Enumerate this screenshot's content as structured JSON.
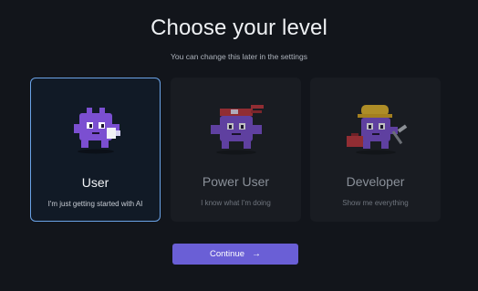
{
  "title": "Choose your level",
  "subtitle": "You can change this later in the settings",
  "options": [
    {
      "name": "User",
      "description": "I'm just getting started with AI",
      "selected": true
    },
    {
      "name": "Power User",
      "description": "I know what I'm doing",
      "selected": false
    },
    {
      "name": "Developer",
      "description": "Show me everything",
      "selected": false
    }
  ],
  "continue_label": "Continue",
  "continue_icon": "arrow-right-icon",
  "colors": {
    "background": "#12151b",
    "card": "#191c22",
    "selected_border": "#6aa2e6",
    "accent": "#6a5fd6",
    "mascot": "#7b4fd1"
  }
}
